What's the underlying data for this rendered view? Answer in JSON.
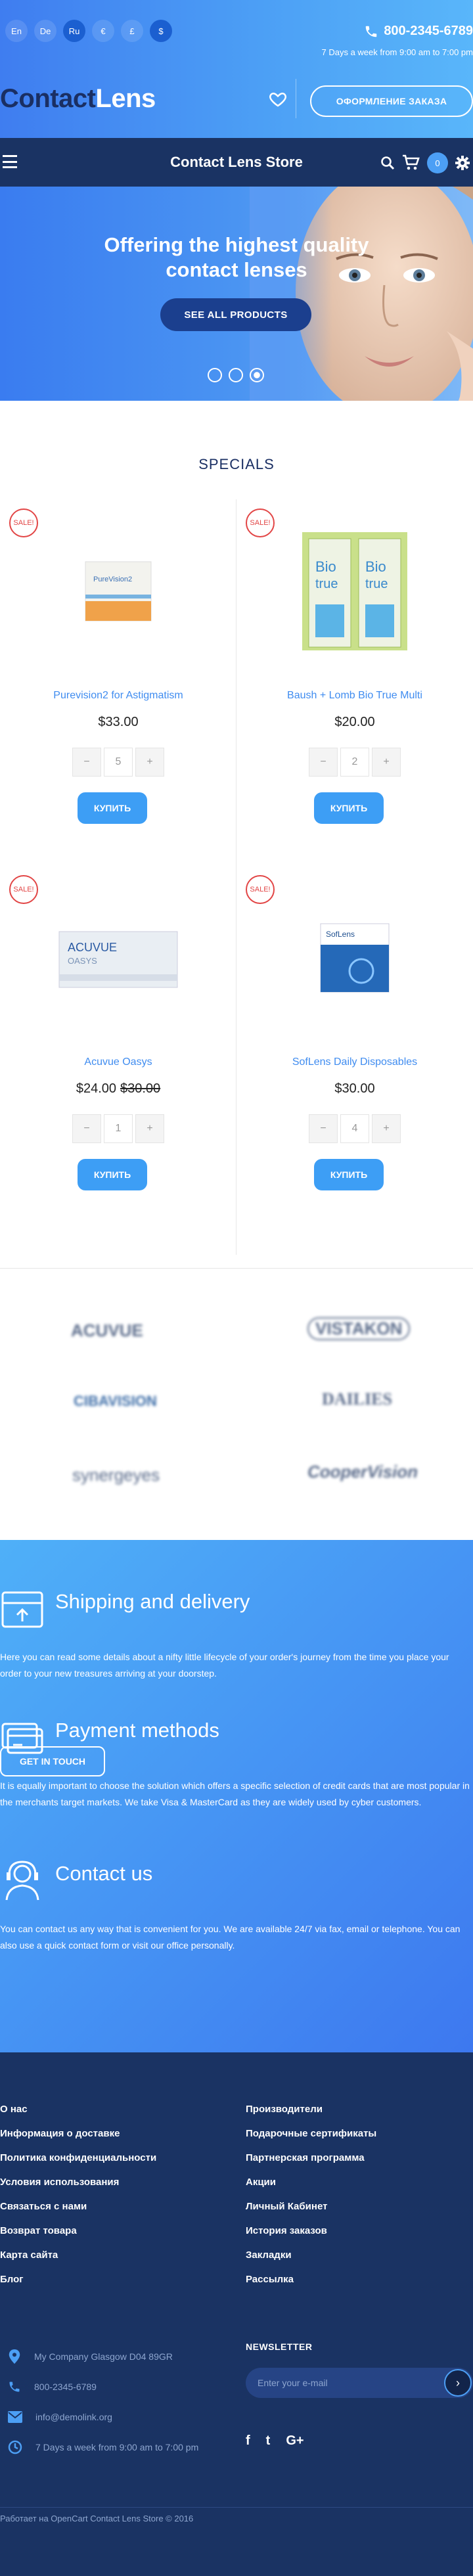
{
  "header": {
    "languages": [
      "En",
      "De",
      "Ru"
    ],
    "currencies": [
      "€",
      "£",
      "$"
    ],
    "phone": "800-2345-6789",
    "hours": "7 Days a week from 9:00 am to 7:00 pm",
    "logo_part1": "Contact",
    "logo_part2": "Lens",
    "order_button": "ОФОРМЛЕНИЕ ЗАКАЗА"
  },
  "nav": {
    "title": "Contact Lens Store",
    "cart_count": "0"
  },
  "hero": {
    "text": "Offering the highest quality contact lenses",
    "button": "SEE ALL PRODUCTS",
    "slides": 3,
    "active_slide": 3
  },
  "specials": {
    "title": "SPECIALS",
    "sale_label": "SALE!",
    "buy_label": "КУПИТЬ",
    "products": [
      {
        "name": "Purevision2 for Astigmatism",
        "price": "$33.00",
        "old_price": "",
        "qty": "5"
      },
      {
        "name": "Baush + Lomb Bio True Multi",
        "price": "$20.00",
        "old_price": "",
        "qty": "2"
      },
      {
        "name": "Acuvue Oasys",
        "price": "$24.00",
        "old_price": "$30.00",
        "qty": "1"
      },
      {
        "name": "SofLens Daily Disposables",
        "price": "$30.00",
        "old_price": "",
        "qty": "4"
      }
    ]
  },
  "brands": [
    "ACUVUE",
    "VISTAKON",
    "CIBAVISION",
    "DAILIES",
    "synergeyes",
    "CooperVision"
  ],
  "info": {
    "shipping_title": "Shipping and delivery",
    "shipping_text": "Here you can read some details about a nifty little lifecycle of your order's journey from the time you place your order to your new treasures arriving at your doorstep.",
    "payment_title": "Payment methods",
    "payment_text": "It is equally important to choose the solution which offers a specific selection of credit cards that are most popular in the merchants target markets. We take Visa & MasterCard as they are widely used by cyber customers.",
    "contact_title": "Contact us",
    "contact_text": "You can contact us any way that is convenient for you. We are available 24/7 via fax, email or telephone. You can also use a quick contact form or visit our office personally.",
    "contact_button": "GET IN TOUCH"
  },
  "footer": {
    "col1": [
      "О нас",
      "Информация о доставке",
      "Политика конфиденциальности",
      "Условия использования",
      "Связаться с нами",
      "Возврат товара",
      "Карта сайта",
      "Блог"
    ],
    "col2": [
      "Производители",
      "Подарочные сертификаты",
      "Партнерская программа",
      "Акции",
      "Личный Кабинет",
      "История заказов",
      "Закладки",
      "Рассылка"
    ],
    "address": "My Company Glasgow D04 89GR",
    "phone": "800-2345-6789",
    "email": "info@demolink.org",
    "hours": "7 Days a week from 9:00 am to 7:00 pm",
    "newsletter_title": "NEWSLETTER",
    "newsletter_placeholder": "Enter your e-mail",
    "social": [
      "f",
      "t",
      "G+"
    ],
    "copyright": "Работает на OpenCart Contact Lens Store © 2016"
  },
  "colors": {
    "brand_blue": "#4c9ff5",
    "navy": "#1a3363",
    "sale_red": "#e24545"
  }
}
